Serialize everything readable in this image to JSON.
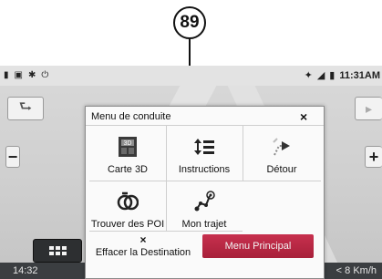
{
  "callout": {
    "number": "89"
  },
  "status_bar": {
    "time": "11:31AM",
    "left_icons": [
      "sms-icon",
      "image-icon",
      "bluetooth-icon",
      "power-icon"
    ],
    "right_icons": [
      "location-icon",
      "signal-icon",
      "battery-icon"
    ]
  },
  "map": {
    "bottom_clock": "14:32",
    "speed": "< 8 Km/h"
  },
  "dialog": {
    "title": "Menu de conduite",
    "close_glyph": "×",
    "items": [
      {
        "label": "Carte 3D",
        "icon": "map-3d-icon"
      },
      {
        "label": "Instructions",
        "icon": "instructions-icon"
      },
      {
        "label": "Détour",
        "icon": "detour-icon"
      },
      {
        "label": "Trouver des POI",
        "icon": "poi-search-icon"
      },
      {
        "label": "Mon trajet",
        "icon": "route-icon"
      }
    ],
    "clear_glyph": "×",
    "clear_label": "Effacer la Destination",
    "main_menu_label": "Menu Principal"
  },
  "colors": {
    "accent": "#b52642",
    "dark_bar": "#3b3e41"
  }
}
